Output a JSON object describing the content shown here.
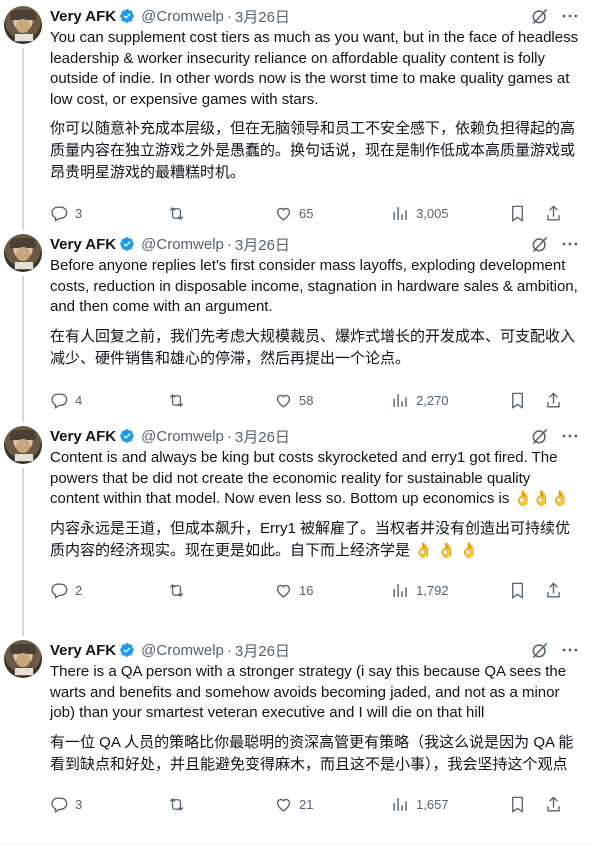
{
  "author": {
    "name": "Very AFK",
    "handle": "@Cromwelp",
    "sep": "·"
  },
  "tweets": [
    {
      "date": "3月26日",
      "text": "You can supplement cost tiers as much as you want, but in the face of headless leadership & worker insecurity reliance on affordable quality content is folly outside of indie. In other words now is the worst time to make quality games at low cost, or expensive games with stars.",
      "translation": "你可以随意补充成本层级，但在无脑领导和员工不安全感下，依赖负担得起的高质量内容在独立游戏之外是愚蠢的。换句话说，现在是制作低成本高质量游戏或昂贵明星游戏的最糟糕时机。",
      "replies": "3",
      "retweets": "",
      "likes": "65",
      "views": "3,005"
    },
    {
      "date": "3月26日",
      "text": "Before anyone replies let's first consider mass layoffs, exploding development costs, reduction in disposable income, stagnation in hardware sales & ambition, and then come with an argument.",
      "translation": "在有人回复之前，我们先考虑大规模裁员、爆炸式增长的开发成本、可支配收入减少、硬件销售和雄心的停滞，然后再提出一个论点。",
      "replies": "4",
      "retweets": "",
      "likes": "58",
      "views": "2,270"
    },
    {
      "date": "3月26日",
      "text": "Content is and always be king but costs skyrocketed and erry1 got fired. The powers that be did not create the economic reality for sustainable quality content within that model. Now even less so. Bottom up economics is 👌👌👌",
      "translation": "内容永远是王道，但成本飙升，Erry1 被解雇了。当权者并没有创造出可持续优质内容的经济现实。现在更是如此。自下而上经济学是 👌 👌 👌",
      "replies": "2",
      "retweets": "",
      "likes": "16",
      "views": "1,792"
    },
    {
      "date": "3月26日",
      "text": "There is a QA person with a stronger strategy (i say this because QA sees the warts and benefits and somehow avoids becoming jaded, and not as a minor job) than your smartest veteran executive and I will die on that hill",
      "translation": "有一位 QA 人员的策略比你最聪明的资深高管更有策略（我这么说是因为 QA 能看到缺点和好处，并且能避免变得麻木，而且这不是小事），我会坚持这个观点",
      "replies": "3",
      "retweets": "",
      "likes": "21",
      "views": "1,657"
    }
  ]
}
